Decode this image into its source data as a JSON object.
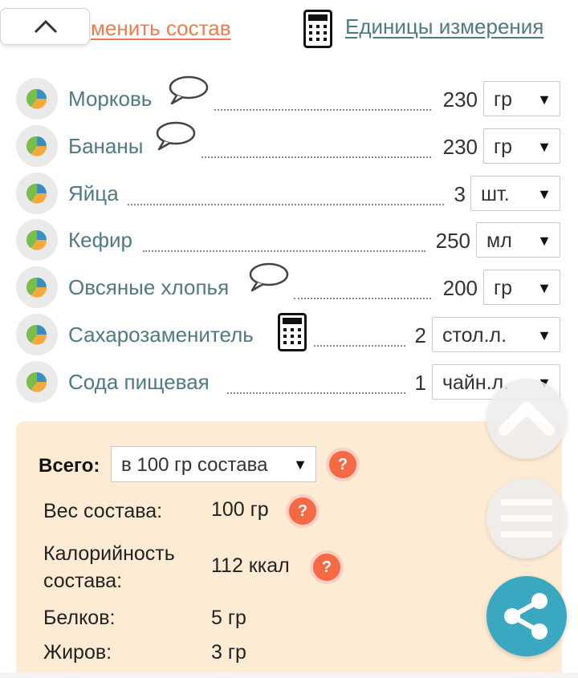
{
  "header": {
    "change_label": "менить состав",
    "units_label": "Единицы измерения"
  },
  "ingredients": [
    {
      "name": "Морковь",
      "qty": "230",
      "unit": "гр",
      "has_comment": true
    },
    {
      "name": "Бананы",
      "qty": "230",
      "unit": "гр",
      "has_comment": true
    },
    {
      "name": "Яйца",
      "qty": "3",
      "unit": "шт."
    },
    {
      "name": "Кефир",
      "qty": "250",
      "unit": "мл"
    },
    {
      "name": "Овсяные хлопья",
      "qty": "200",
      "unit": "гр",
      "has_comment": true
    },
    {
      "name": "Сахарозаменитель",
      "qty": "2",
      "unit": "стол.л.",
      "has_calculator": true
    },
    {
      "name": "Сода пищевая",
      "qty": "1",
      "unit": "чайн.л."
    }
  ],
  "select_arrow": "▼",
  "summary": {
    "total_label": "Всего:",
    "basis_value": "в 100 гр состава",
    "help_glyph": "?",
    "stats": [
      {
        "label": "Вес состава:",
        "value": "100 гр"
      },
      {
        "label": "Калорийность\nсостава:",
        "value": "112 ккал"
      },
      {
        "label": "Белков:",
        "value": "5 гр"
      },
      {
        "label": "Жиров:",
        "value": "3 гр"
      }
    ]
  },
  "colors": {
    "link_orange": "#f07b4c",
    "link_teal": "#4f7a84",
    "panel_bg": "#fdebd3",
    "help_red": "#f56a45",
    "share_blue": "#3aa8c1"
  },
  "icons": {
    "collapse": "chevron-up-icon",
    "calculator": "calculator-icon",
    "comment": "speech-bubble-icon",
    "nutrition": "pie-chart-icon",
    "help": "question-icon",
    "scroll_top": "chevron-up-icon",
    "menu": "hamburger-icon",
    "share": "share-icon"
  }
}
